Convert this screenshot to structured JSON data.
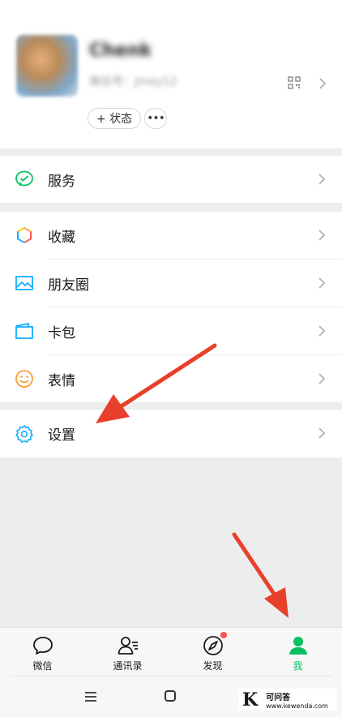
{
  "profile": {
    "nickname": "Chenk",
    "wechat_id": "微信号：Jmey12",
    "status_button_label": "+ 状态",
    "more_button_label": "•••"
  },
  "menu": {
    "services": {
      "label": "服务",
      "icon": "wechat-pay-icon"
    },
    "favorites": {
      "label": "收藏",
      "icon": "cube-icon"
    },
    "moments": {
      "label": "朋友圈",
      "icon": "photo-icon"
    },
    "cards": {
      "label": "卡包",
      "icon": "wallet-card-icon"
    },
    "stickers": {
      "label": "表情",
      "icon": "smiley-icon"
    },
    "settings": {
      "label": "设置",
      "icon": "gear-icon"
    }
  },
  "tabbar": {
    "chats": "微信",
    "contacts": "通讯录",
    "discover": "发现",
    "me": "我",
    "active": "me"
  },
  "watermark": {
    "logo_letter": "K",
    "title": "可问答",
    "url": "www.kewenda.com"
  },
  "colors": {
    "accent_green": "#07c160",
    "badge_red": "#fa5151",
    "arrow_red": "#e8402a"
  }
}
